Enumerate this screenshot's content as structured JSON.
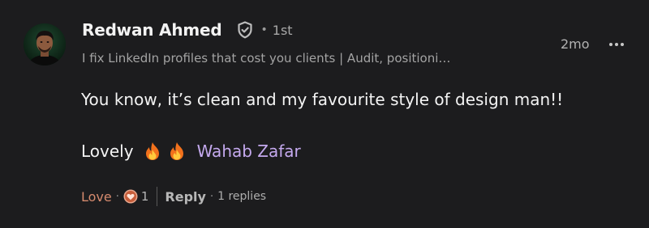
{
  "author": {
    "name": "Redwan Ahmed",
    "degree": "1st",
    "headline": "I fix LinkedIn profiles that cost you clients | Audit, positioni…"
  },
  "timestamp": "2mo",
  "comment": {
    "line1": "You know, it’s clean and my favourite style of design man!!",
    "line2_text": "Lovely",
    "emojis": [
      "fire-emoji",
      "fire-emoji"
    ],
    "mention": "Wahab Zafar"
  },
  "actions": {
    "love_label": "Love",
    "separator": "·",
    "reaction_count": "1",
    "reply_label": "Reply",
    "replies_text": "1 replies"
  },
  "colors": {
    "background": "#1c1c1e",
    "text": "#f4f4f4",
    "muted": "#a3a3a3",
    "mention": "#c4a9ee",
    "love": "#d58a6e"
  }
}
